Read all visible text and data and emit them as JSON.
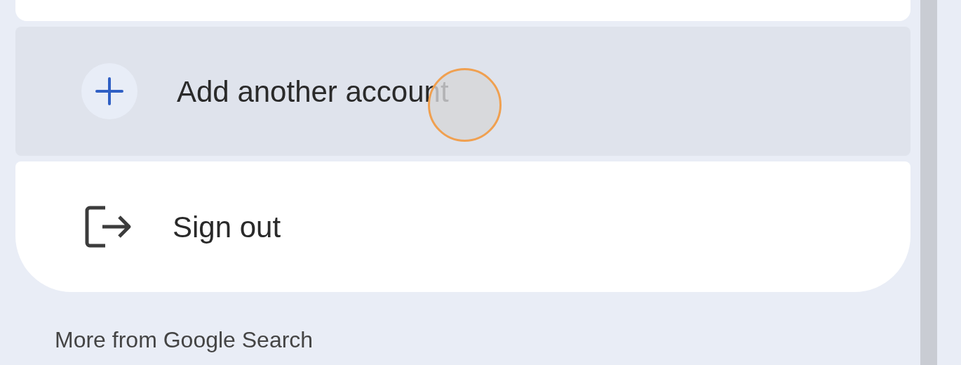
{
  "menu_items": [
    {
      "kind": "add",
      "label": "Add another account",
      "highlighted": true
    },
    {
      "kind": "signout",
      "label": "Sign out",
      "highlighted": false
    }
  ],
  "section_heading": "More from Google Search"
}
